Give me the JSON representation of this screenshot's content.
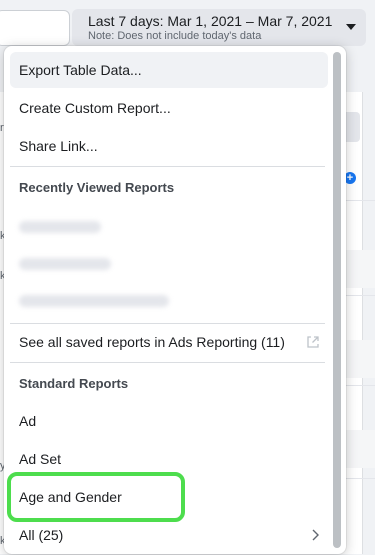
{
  "date_range": {
    "label": "Last 7 days: Mar 1, 2021 – Mar 7, 2021",
    "note": "Note: Does not include today's data"
  },
  "menu": {
    "actions": [
      {
        "label": "Export Table Data..."
      },
      {
        "label": "Create Custom Report..."
      },
      {
        "label": "Share Link..."
      }
    ],
    "recent_heading": "Recently Viewed Reports",
    "see_all_label": "See all saved reports in Ads Reporting (11)",
    "standard_heading": "Standard Reports",
    "standard_items": [
      {
        "label": "Ad"
      },
      {
        "label": "Ad Set"
      },
      {
        "label": "Age and Gender"
      },
      {
        "label": "All (25)"
      }
    ]
  },
  "background": {
    "fragments": [
      "rf",
      "k",
      "k",
      "y",
      "k"
    ]
  },
  "colors": {
    "highlight_border": "#4ddd4d",
    "accent": "#1877f2",
    "button_bg": "#e4e6eb"
  },
  "icons": [
    "external-link-icon",
    "chevron-right-icon",
    "caret-down-icon",
    "plus-circle-icon"
  ]
}
